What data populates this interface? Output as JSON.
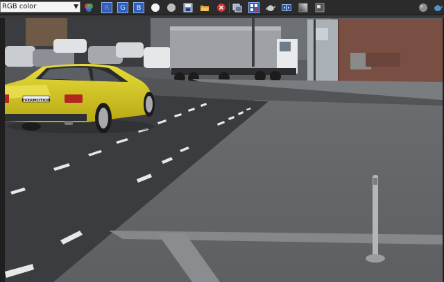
{
  "toolbar": {
    "channel_mode": {
      "selected": "RGB color"
    },
    "channels": {
      "red": "R",
      "green": "G",
      "blue": "B"
    },
    "icons": [
      "color-wheel-icon",
      "channel-red-toggle",
      "channel-green-toggle",
      "channel-blue-toggle",
      "white-circle-icon",
      "gray-circle-icon",
      "save-icon",
      "folder-open-icon",
      "stop-icon",
      "copy-image-icon",
      "fit-region-icon",
      "teapot-icon",
      "compare-icon",
      "gradient-icon",
      "tonemap-icon",
      "settings-sphere-icon",
      "render-teapot-icon"
    ]
  },
  "viewport": {
    "content": "rendered street scene",
    "license_plate": "EVERMOTION"
  },
  "colors": {
    "toolbar_bg": "#2b2b2b",
    "channel_button": "#2f5fb7",
    "car_yellow": "#d9cc1a",
    "road": "#4a4c50"
  }
}
